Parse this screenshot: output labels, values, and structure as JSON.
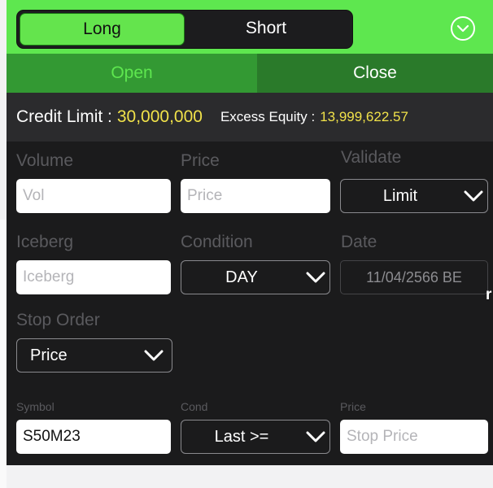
{
  "header": {
    "segment_long": "Long",
    "segment_short": "Short",
    "menu_icon": "chevron-down-circle-icon"
  },
  "tabs": {
    "open": "Open",
    "close": "Close"
  },
  "account": {
    "credit_limit_label": "Credit Limit :",
    "credit_limit_value": "30,000,000",
    "excess_equity_label": "Excess Equity :",
    "excess_equity_value": "13,999,622.57"
  },
  "order": {
    "volume_label": "Volume",
    "volume_placeholder": "Vol",
    "price_label": "Price",
    "price_placeholder": "Price",
    "validate_label": "Validate",
    "validate_value": "Limit",
    "iceberg_label": "Iceberg",
    "iceberg_placeholder": "Iceberg",
    "condition_label": "Condition",
    "condition_value": "DAY",
    "date_label": "Date",
    "date_value": "11/04/2566 BE",
    "stray_char": "r"
  },
  "stop_order": {
    "label": "Stop Order",
    "type_value": "Price",
    "symbol_label": "Symbol",
    "symbol_value": "S50M23",
    "cond_label": "Cond",
    "cond_value": "Last >=",
    "price_label": "Price",
    "price_placeholder": "Stop Price"
  },
  "colors": {
    "accent_green": "#5ee74f",
    "open_tab": "#339933",
    "close_tab": "#2a7a2a",
    "highlight_yellow": "#f1e24a",
    "background_dark": "#1b1b1c"
  }
}
